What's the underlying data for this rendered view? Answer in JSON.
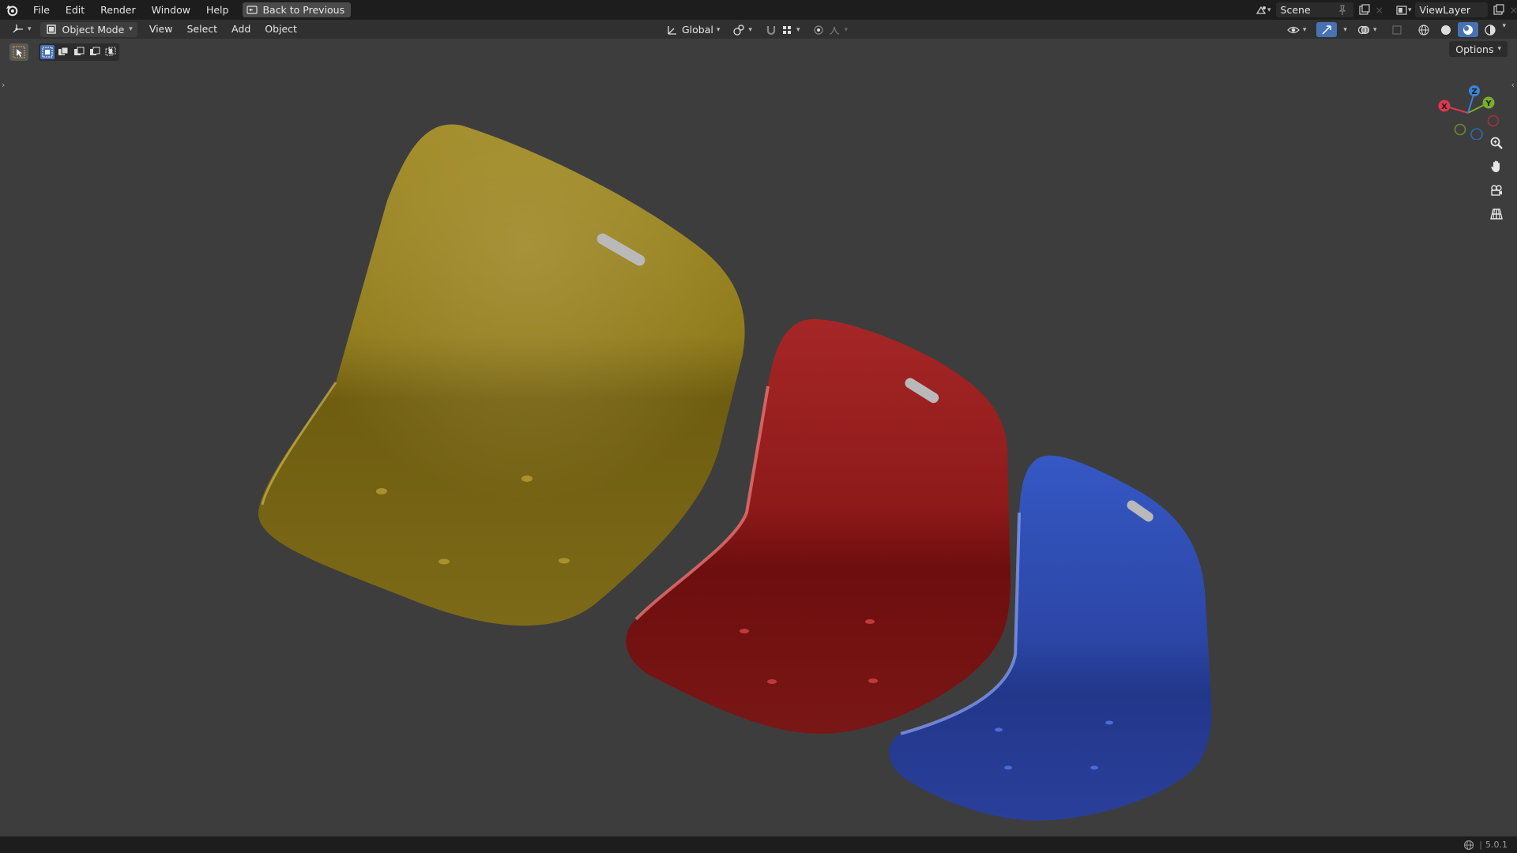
{
  "app": {
    "name": "Blender",
    "version": "5.0.1"
  },
  "topbar": {
    "menus": [
      "File",
      "Edit",
      "Render",
      "Window",
      "Help"
    ],
    "back_label": "Back to Previous",
    "scene_name": "Scene",
    "view_layer": "ViewLayer"
  },
  "header": {
    "mode": "Object Mode",
    "menus": [
      "View",
      "Select",
      "Add",
      "Object"
    ],
    "orientation": "Global"
  },
  "viewport": {
    "options_label": "Options",
    "gizmo_axes": [
      "X",
      "Y",
      "Z"
    ],
    "objects": [
      {
        "name": "yellow-chair-shell",
        "color": "#8a7418"
      },
      {
        "name": "red-chair-shell",
        "color": "#8e1a1a"
      },
      {
        "name": "blue-chair-shell",
        "color": "#2c46a6"
      }
    ]
  },
  "statusbar": {
    "version_text": "5.0.1"
  },
  "colors": {
    "accent": "#4772b3",
    "axis_x": "#e0374f",
    "axis_y": "#7aae2c",
    "axis_z": "#3a84d9"
  }
}
